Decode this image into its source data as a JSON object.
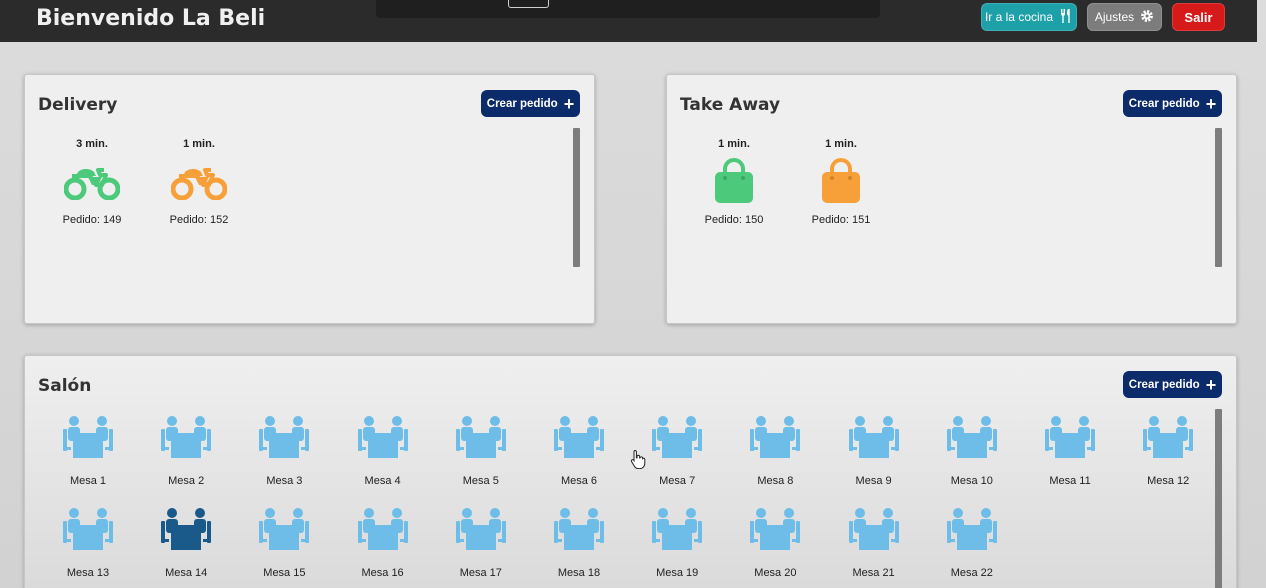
{
  "header": {
    "title": "Bienvenido La Beli",
    "kitchen_label": "Ir a la cocina",
    "settings_label": "Ajustes",
    "exit_label": "Salir",
    "kitchen_color": "#1ea0a8",
    "exit_color": "#d61a1a"
  },
  "delivery": {
    "title": "Delivery",
    "create_label": "Crear pedido",
    "orders": [
      {
        "time": "3 min.",
        "label": "Pedido: 149",
        "color": "#4cc97a",
        "icon": "motorcycle-icon"
      },
      {
        "time": "1 min.",
        "label": "Pedido: 152",
        "color": "#f7a039",
        "icon": "motorcycle-icon"
      }
    ]
  },
  "takeaway": {
    "title": "Take Away",
    "create_label": "Crear pedido",
    "orders": [
      {
        "time": "1 min.",
        "label": "Pedido: 150",
        "color": "#4cc97a",
        "icon": "shopping-bag-icon"
      },
      {
        "time": "1 min.",
        "label": "Pedido: 151",
        "color": "#f7a039",
        "icon": "shopping-bag-icon"
      }
    ]
  },
  "salon": {
    "title": "Salón",
    "create_label": "Crear pedido",
    "free_color": "#6dbde8",
    "occupied_color": "#1a5a8a",
    "tables": [
      {
        "label": "Mesa 1",
        "occupied": false
      },
      {
        "label": "Mesa 2",
        "occupied": false
      },
      {
        "label": "Mesa 3",
        "occupied": false
      },
      {
        "label": "Mesa 4",
        "occupied": false
      },
      {
        "label": "Mesa 5",
        "occupied": false
      },
      {
        "label": "Mesa 6",
        "occupied": false
      },
      {
        "label": "Mesa 7",
        "occupied": false
      },
      {
        "label": "Mesa 8",
        "occupied": false
      },
      {
        "label": "Mesa 9",
        "occupied": false
      },
      {
        "label": "Mesa 10",
        "occupied": false
      },
      {
        "label": "Mesa 11",
        "occupied": false
      },
      {
        "label": "Mesa 12",
        "occupied": false
      },
      {
        "label": "Mesa 13",
        "occupied": false
      },
      {
        "label": "Mesa 14",
        "occupied": true
      },
      {
        "label": "Mesa 15",
        "occupied": false
      },
      {
        "label": "Mesa 16",
        "occupied": false
      },
      {
        "label": "Mesa 17",
        "occupied": false
      },
      {
        "label": "Mesa 18",
        "occupied": false
      },
      {
        "label": "Mesa 19",
        "occupied": false
      },
      {
        "label": "Mesa 20",
        "occupied": false
      },
      {
        "label": "Mesa 21",
        "occupied": false
      },
      {
        "label": "Mesa 22",
        "occupied": false
      }
    ]
  }
}
